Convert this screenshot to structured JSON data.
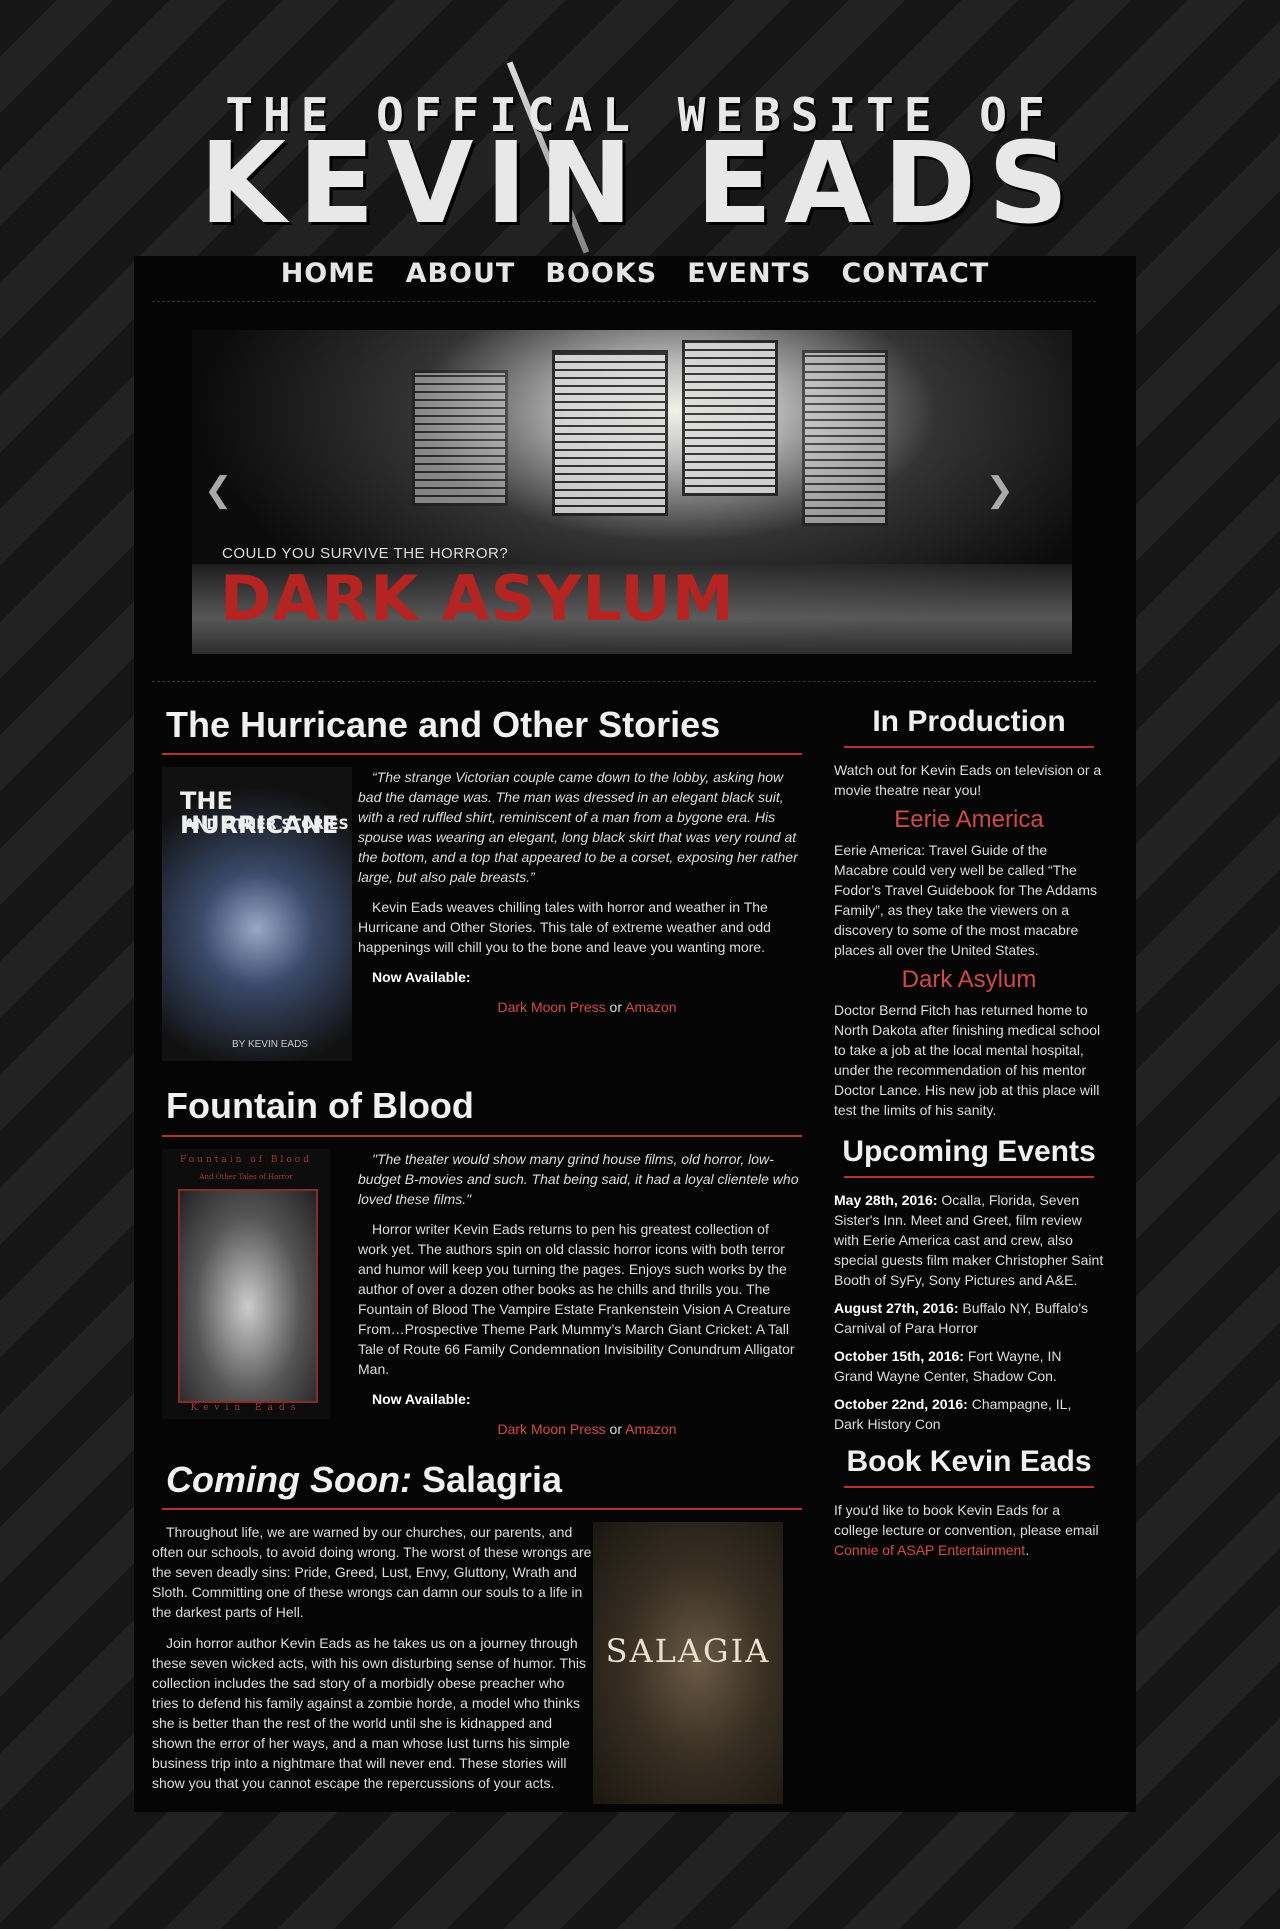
{
  "header": {
    "line1": "THE OFFICAL WEBSITE OF",
    "line2": "KEVIN EADS"
  },
  "nav": {
    "items": [
      "HOME",
      "ABOUT",
      "BOOKS",
      "EVENTS",
      "CONTACT"
    ]
  },
  "slider": {
    "tagline": "COULD YOU SURVIVE THE HORROR?",
    "title": "DARK ASYLUM",
    "prev_icon": "chevron-left-icon",
    "next_icon": "chevron-right-icon"
  },
  "books": [
    {
      "title": "The Hurricane and Other Stories",
      "cover": {
        "line1": "THE HURRICANE",
        "line2": "AND OTHER STORIES",
        "line3": "BY KEVIN EADS"
      },
      "quote": "“The strange Victorian couple came down to the lobby, asking how bad the damage was. The man was dressed in an elegant black suit, with a red ruffled shirt, reminiscent of a man from a bygone era. His spouse was wearing an elegant, long black skirt that was very round at the bottom, and a top that appeared to be a corset, exposing her rather large, but also pale breasts.”",
      "desc": "Kevin Eads weaves chilling tales with horror and weather in The Hurricane and Other Stories. This tale of extreme weather and odd happenings will chill you to the bone and leave you wanting more.",
      "available": "Now Available:",
      "link1": "Dark Moon Press",
      "or": "or",
      "link2": "Amazon"
    },
    {
      "title": "Fountain of Blood",
      "cover": {
        "line1": "Fountain of Blood",
        "line2": "And Other Tales of Horror",
        "line3": "Kevin Eads"
      },
      "quote": "\"The theater would show many grind house films, old horror, low-budget B-movies and such. That being said, it had a loyal clientele who loved these films.\"",
      "desc": "Horror writer Kevin Eads returns to pen his greatest collection of work yet. The authors spin on old classic horror icons with both terror and humor will keep you turning the pages. Enjoys such works by the author of over a dozen other books as he chills and thrills you. The Fountain of Blood The Vampire Estate Frankenstein Vision A Creature From…Prospective Theme Park Mummy’s March Giant Cricket: A Tall Tale of Route 66 Family Condemnation Invisibility Conundrum Alligator Man.",
      "available": "Now Available:",
      "link1": "Dark Moon Press",
      "or": "or",
      "link2": "Amazon"
    }
  ],
  "coming_soon": {
    "prefix": "Coming Soon:",
    "title": "Salagria",
    "cover_title": "SALAGIA",
    "p1": "Throughout life, we are warned by our churches, our parents, and often our schools, to avoid doing wrong. The worst of these wrongs are the seven deadly sins: Pride, Greed, Lust, Envy, Gluttony, Wrath and Sloth. Committing one of these wrongs can damn our souls to a life in the darkest parts of Hell.",
    "p2": "Join horror author Kevin Eads as he takes us on a journey through these seven wicked acts, with his own disturbing sense of humor. This collection includes the sad story of a morbidly obese preacher who tries to defend his family against a zombie horde, a model who thinks she is better than the rest of the world until she is kidnapped and shown the error of her ways, and a man whose lust turns his simple business trip into a nightmare that will never end. These stories will show you that you cannot escape the repercussions of your acts."
  },
  "sidebar": {
    "production_title": "In Production",
    "production_intro": "Watch out for Kevin Eads on television or a movie theatre near you!",
    "eerie_title": "Eerie America",
    "eerie_text": "Eerie America: Travel Guide of the Macabre could very well be called “The Fodor’s Travel Guidebook for The Addams Family”, as they take the viewers on a discovery to some of the most macabre places all over the United States.",
    "asylum_title": "Dark Asylum",
    "asylum_text": "Doctor Bernd Fitch has returned home to North Dakota after finishing medical school to take a job at the local mental hospital, under the recommendation of his mentor Doctor Lance. His new job at this place will test the limits of his sanity.",
    "events_title": "Upcoming Events",
    "events": [
      {
        "date": "May 28th, 2016:",
        "text": " Ocalla, Florida, Seven Sister's Inn. Meet and Greet, film review with Eerie America cast and crew, also special guests film maker Christopher Saint Booth of SyFy, Sony Pictures and A&E."
      },
      {
        "date": "August 27th, 2016:",
        "text": " Buffalo NY, Buffalo's Carnival of Para Horror"
      },
      {
        "date": "October 15th, 2016:",
        "text": " Fort Wayne, IN Grand Wayne Center, Shadow Con."
      },
      {
        "date": "October 22nd, 2016:",
        "text": " Champagne, IL, Dark History Con"
      }
    ],
    "book_title": "Book Kevin Eads",
    "book_text": "If you'd like to book Kevin Eads for a college lecture or convention, please email ",
    "book_link": "Connie of ASAP Entertainment",
    "book_end": "."
  },
  "colors": {
    "accent": "#b8312b",
    "link": "#d44b44",
    "background": "#050505"
  }
}
